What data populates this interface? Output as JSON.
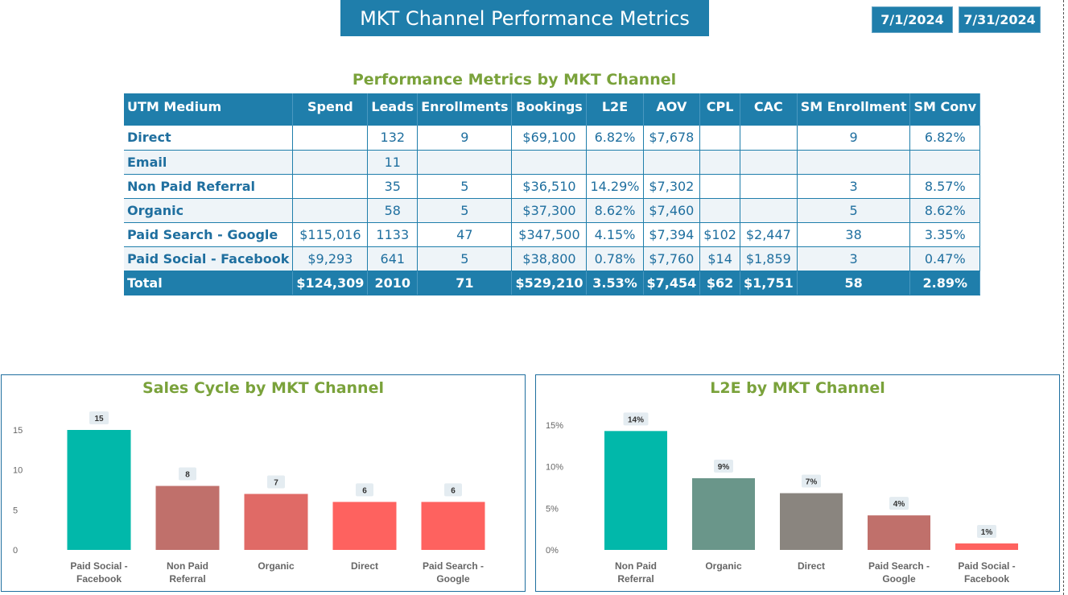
{
  "header": {
    "title": "MKT Channel Performance Metrics",
    "date_start": "7/1/2024",
    "date_end": "7/31/2024"
  },
  "table": {
    "title": "Performance Metrics by MKT Channel",
    "columns": [
      "UTM Medium",
      "Spend",
      "Leads",
      "Enrollments",
      "Bookings",
      "L2E",
      "AOV",
      "CPL",
      "CAC",
      "SM Enrollment",
      "SM Conv"
    ],
    "rows": [
      [
        "Direct",
        "",
        "132",
        "9",
        "$69,100",
        "6.82%",
        "$7,678",
        "",
        "",
        "9",
        "6.82%"
      ],
      [
        "Email",
        "",
        "11",
        "",
        "",
        "",
        "",
        "",
        "",
        "",
        ""
      ],
      [
        "Non Paid Referral",
        "",
        "35",
        "5",
        "$36,510",
        "14.29%",
        "$7,302",
        "",
        "",
        "3",
        "8.57%"
      ],
      [
        "Organic",
        "",
        "58",
        "5",
        "$37,300",
        "8.62%",
        "$7,460",
        "",
        "",
        "5",
        "8.62%"
      ],
      [
        "Paid Search - Google",
        "$115,016",
        "1133",
        "47",
        "$347,500",
        "4.15%",
        "$7,394",
        "$102",
        "$2,447",
        "38",
        "3.35%"
      ],
      [
        "Paid Social - Facebook",
        "$9,293",
        "641",
        "5",
        "$38,800",
        "0.78%",
        "$7,760",
        "$14",
        "$1,859",
        "3",
        "0.47%"
      ]
    ],
    "total": [
      "Total",
      "$124,309",
      "2010",
      "71",
      "$529,210",
      "3.53%",
      "$7,454",
      "$62",
      "$1,751",
      "58",
      "2.89%"
    ]
  },
  "chart_data": [
    {
      "type": "bar",
      "title": "Sales Cycle by MKT Channel",
      "categories": [
        "Paid Social - Facebook",
        "Non Paid Referral",
        "Organic",
        "Direct",
        "Paid Search - Google"
      ],
      "values": [
        15,
        8,
        7,
        6,
        6
      ],
      "data_labels": [
        "15",
        "8",
        "7",
        "6",
        "6"
      ],
      "ylim": [
        0,
        15
      ],
      "yticks": [
        0,
        5,
        10,
        15
      ],
      "ytick_labels": [
        "0",
        "5",
        "10",
        "15"
      ],
      "colors": [
        "#01b8aa",
        "#c0706b",
        "#e06a66",
        "#fe625f",
        "#fe625f"
      ]
    },
    {
      "type": "bar",
      "title": "L2E by MKT Channel",
      "categories": [
        "Non Paid Referral",
        "Organic",
        "Direct",
        "Paid Search - Google",
        "Paid Social - Facebook"
      ],
      "values": [
        14.29,
        8.62,
        6.82,
        4.15,
        0.78
      ],
      "data_labels": [
        "14%",
        "9%",
        "7%",
        "4%",
        "1%"
      ],
      "ylim": [
        0,
        15
      ],
      "yticks": [
        0,
        5,
        10,
        15
      ],
      "ytick_labels": [
        "0%",
        "5%",
        "10%",
        "15%"
      ],
      "colors": [
        "#01b8aa",
        "#6a968a",
        "#8a857f",
        "#c0706b",
        "#fe625f"
      ]
    }
  ]
}
